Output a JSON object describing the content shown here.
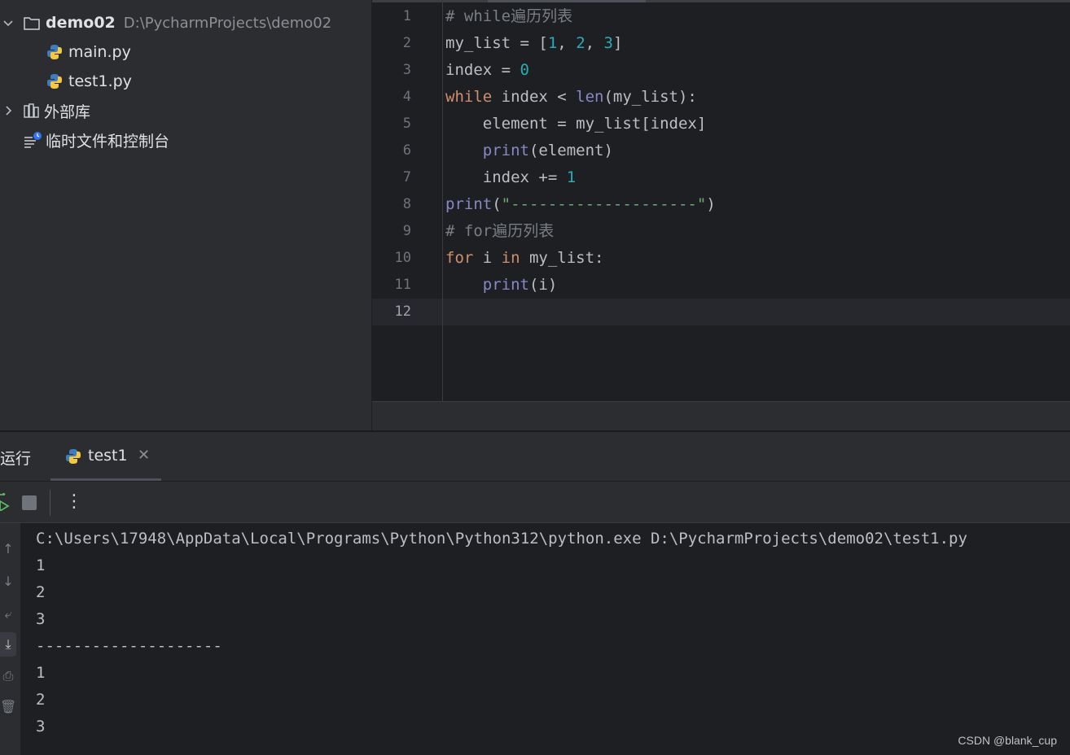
{
  "project": {
    "root": {
      "name": "demo02",
      "path": "D:\\PycharmProjects\\demo02"
    },
    "files": [
      "main.py",
      "test1.py"
    ],
    "external_libraries": "外部库",
    "scratches": "临时文件和控制台"
  },
  "editor": {
    "line_numbers": [
      "1",
      "2",
      "3",
      "4",
      "5",
      "6",
      "7",
      "8",
      "9",
      "10",
      "11",
      "12"
    ],
    "comment_while": "# while遍历列表",
    "comment_for": "# for遍历列表",
    "separator_literal": "\"--------------------\"",
    "current_line": 12
  },
  "run": {
    "tool_title": "运行",
    "tab_label": "test1",
    "console_lines": [
      "C:\\Users\\17948\\AppData\\Local\\Programs\\Python\\Python312\\python.exe D:\\PycharmProjects\\demo02\\test1.py",
      "1",
      "2",
      "3",
      "--------------------",
      "1",
      "2",
      "3"
    ]
  },
  "watermark": "CSDN @blank_cup",
  "colors": {
    "keyword": "#cf8e6d",
    "number": "#2aacb8",
    "builtin": "#8888c6",
    "string": "#6aab73",
    "comment": "#7a7e85"
  }
}
